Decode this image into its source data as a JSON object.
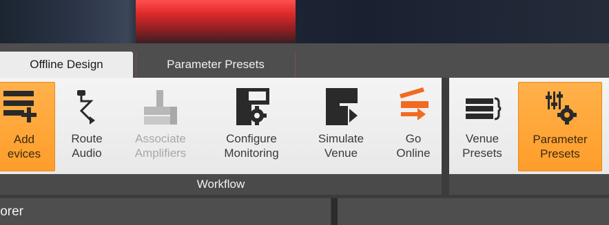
{
  "tabs": [
    {
      "label": "Offline Design",
      "selected": true
    },
    {
      "label": "Parameter Presets",
      "selected": false,
      "accent": "#e02a2a"
    }
  ],
  "ribbon": {
    "workflow": {
      "label": "Workflow",
      "buttons": [
        {
          "label1": "Add",
          "label2": "evices",
          "icon": "add-devices-icon",
          "active": true
        },
        {
          "label1": "Route",
          "label2": "Audio",
          "icon": "route-audio-icon"
        },
        {
          "label1": "Associate",
          "label2": "Amplifiers",
          "icon": "associate-amplifiers-icon",
          "disabled": true
        },
        {
          "label1": "Configure",
          "label2": "Monitoring",
          "icon": "configure-monitoring-icon"
        },
        {
          "label1": "Simulate",
          "label2": "Venue",
          "icon": "simulate-venue-icon"
        },
        {
          "label1": "Go",
          "label2": "Online",
          "icon": "go-online-icon",
          "color": "#f26a22"
        }
      ]
    },
    "presets": {
      "label": "",
      "buttons": [
        {
          "label1": "Venue",
          "label2": "Presets",
          "icon": "venue-presets-icon"
        },
        {
          "label1": "Parameter",
          "label2": "Presets",
          "icon": "parameter-presets-icon",
          "active": true
        }
      ]
    }
  },
  "explorer": {
    "title": "lorer"
  },
  "colors": {
    "active": "#ffa333",
    "go_online": "#f26a22",
    "titlebar_red": "#e02a2a"
  }
}
